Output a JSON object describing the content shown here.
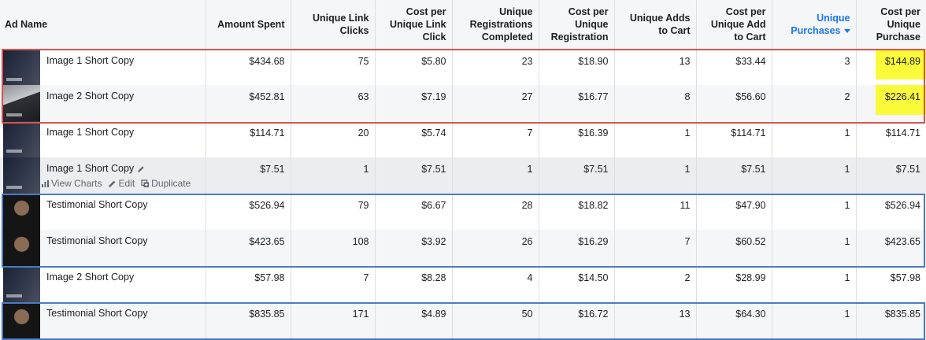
{
  "headers": [
    {
      "label": "Ad Name"
    },
    {
      "label": "Amount Spent"
    },
    {
      "label": "Unique Link Clicks"
    },
    {
      "label": "Cost per Unique Link Click"
    },
    {
      "label": "Unique Registrations Completed"
    },
    {
      "label": "Cost per Unique Registration"
    },
    {
      "label": "Unique Adds to Cart"
    },
    {
      "label": "Cost per Unique Add to Cart"
    },
    {
      "label": "Unique Purchases"
    },
    {
      "label": "Cost per Unique Purchase"
    }
  ],
  "row_actions": {
    "view_charts": "View Charts",
    "edit": "Edit",
    "duplicate": "Duplicate"
  },
  "rows": [
    {
      "name": "Image 1 Short Copy",
      "spent": "$434.68",
      "clicks": "75",
      "cpc": "$5.80",
      "regs": "23",
      "cpr": "$18.90",
      "atc": "13",
      "cpatc": "$33.44",
      "purch": "3",
      "cpp": "$144.89"
    },
    {
      "name": "Image 2 Short Copy",
      "spent": "$452.81",
      "clicks": "63",
      "cpc": "$7.19",
      "regs": "27",
      "cpr": "$16.77",
      "atc": "8",
      "cpatc": "$56.60",
      "purch": "2",
      "cpp": "$226.41"
    },
    {
      "name": "Image 1 Short Copy",
      "spent": "$114.71",
      "clicks": "20",
      "cpc": "$5.74",
      "regs": "7",
      "cpr": "$16.39",
      "atc": "1",
      "cpatc": "$114.71",
      "purch": "1",
      "cpp": "$114.71"
    },
    {
      "name": "Image 1 Short Copy",
      "spent": "$7.51",
      "clicks": "1",
      "cpc": "$7.51",
      "regs": "1",
      "cpr": "$7.51",
      "atc": "1",
      "cpatc": "$7.51",
      "purch": "1",
      "cpp": "$7.51"
    },
    {
      "name": "Testimonial Short Copy",
      "spent": "$526.94",
      "clicks": "79",
      "cpc": "$6.67",
      "regs": "28",
      "cpr": "$18.82",
      "atc": "11",
      "cpatc": "$47.90",
      "purch": "1",
      "cpp": "$526.94"
    },
    {
      "name": "Testimonial Short Copy",
      "spent": "$423.65",
      "clicks": "108",
      "cpc": "$3.92",
      "regs": "26",
      "cpr": "$16.29",
      "atc": "7",
      "cpatc": "$60.52",
      "purch": "1",
      "cpp": "$423.65"
    },
    {
      "name": "Image 2 Short Copy",
      "spent": "$57.98",
      "clicks": "7",
      "cpc": "$8.28",
      "regs": "4",
      "cpr": "$14.50",
      "atc": "2",
      "cpatc": "$28.99",
      "purch": "1",
      "cpp": "$57.98"
    },
    {
      "name": "Testimonial Short Copy",
      "spent": "$835.85",
      "clicks": "171",
      "cpc": "$4.89",
      "regs": "50",
      "cpr": "$16.72",
      "atc": "13",
      "cpatc": "$64.30",
      "purch": "1",
      "cpp": "$835.85"
    }
  ],
  "colors": {
    "sorted_header": "#1877f2",
    "highlight": "#f8fa3a",
    "red_box": "#d9534f",
    "blue_box": "#4a7cc2"
  },
  "icons": {
    "thumbnail": "ad-thumbnail-icon",
    "pencil": "pencil-icon",
    "charts": "bar-chart-icon",
    "edit": "edit-icon",
    "duplicate": "duplicate-icon",
    "sort": "sort-desc-icon"
  }
}
